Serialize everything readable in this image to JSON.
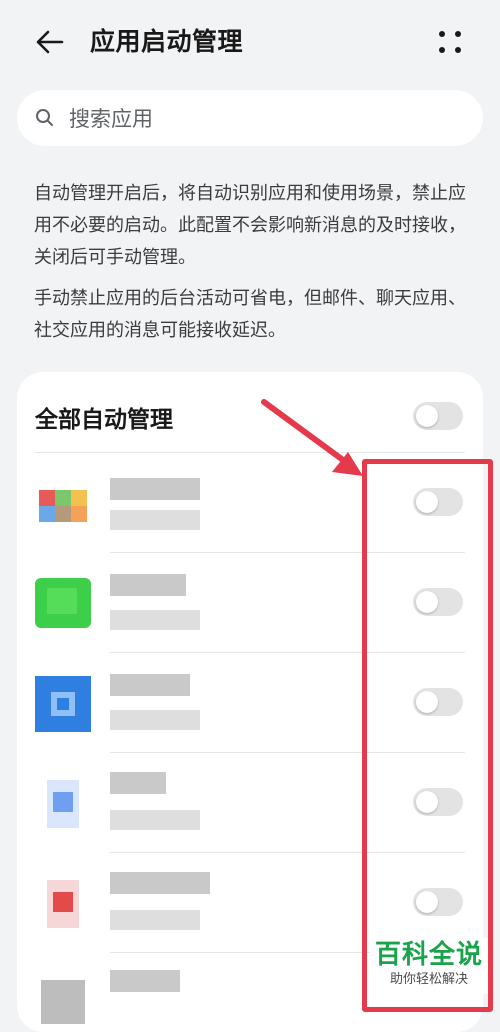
{
  "header": {
    "title": "应用启动管理",
    "back_icon": "arrow-left-icon",
    "more_icon": "more-dots-icon"
  },
  "search": {
    "placeholder": "搜索应用",
    "value": ""
  },
  "description": {
    "paragraph1": "自动管理开启后，将自动识别应用和使用场景，禁止应用不必要的启动。此配置不会影响新消息的及时接收，关闭后可手动管理。",
    "paragraph2": "手动禁止应用的后台活动可省电，但邮件、聊天应用、社交应用的消息可能接收延迟。"
  },
  "all_auto": {
    "label": "全部自动管理",
    "enabled": false
  },
  "apps": [
    {
      "icon": "blurred-app-icon-multicolor",
      "enabled": false
    },
    {
      "icon": "blurred-app-icon-green",
      "enabled": false
    },
    {
      "icon": "blurred-app-icon-blue",
      "enabled": false
    },
    {
      "icon": "blurred-app-icon-lightblue",
      "enabled": false
    },
    {
      "icon": "blurred-app-icon-red",
      "enabled": false
    },
    {
      "icon": "blurred-app-icon-gray",
      "enabled": false
    }
  ],
  "watermark": {
    "main": "百科全说",
    "sub": "助你轻松解决"
  },
  "colors": {
    "background": "#f1f3f5",
    "card": "#ffffff",
    "toggle_off": "#e3e3e3",
    "annotation": "#e43a4c",
    "watermark_green": "#1aa34a"
  }
}
